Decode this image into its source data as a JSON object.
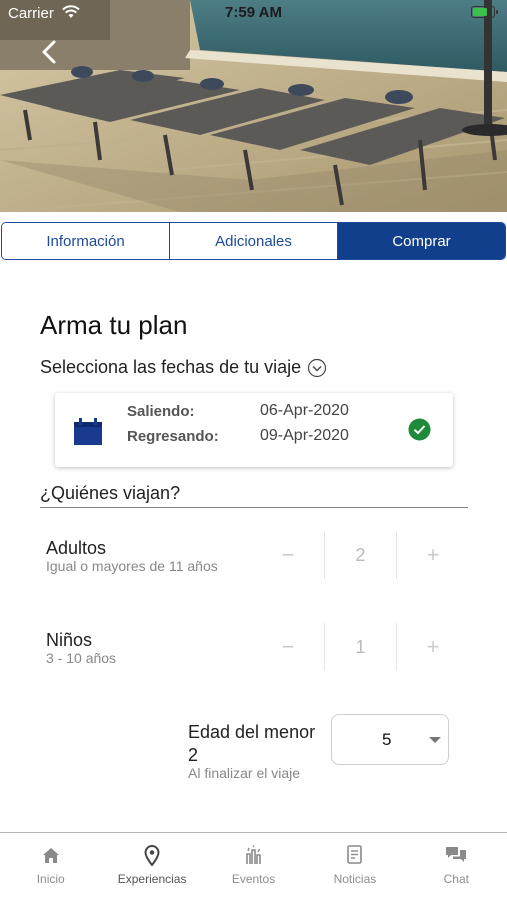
{
  "status_bar": {
    "carrier": "Carrier",
    "time": "7:59 AM"
  },
  "tabs": [
    {
      "label": "Información",
      "active": false
    },
    {
      "label": "Adicionales",
      "active": false
    },
    {
      "label": "Comprar",
      "active": true
    }
  ],
  "plan": {
    "title": "Arma tu plan",
    "dates_prompt": "Selecciona las fechas de tu viaje",
    "departing_label": "Saliendo:",
    "departing_date": "06-Apr-2020",
    "returning_label": "Regresando:",
    "returning_date": "09-Apr-2020"
  },
  "travelers": {
    "heading": "¿Quiénes viajan?",
    "adults": {
      "label": "Adultos",
      "description": "Igual o mayores de 11 años",
      "count": "2"
    },
    "children": {
      "label": "Niños",
      "description": "3 - 10 años",
      "count": "1"
    },
    "stepper_minus": "−",
    "stepper_plus": "+"
  },
  "child_age": {
    "label": "Edad del menor 2",
    "note": "Al finalizar el viaje",
    "selected": "5"
  },
  "bottom_nav": [
    {
      "label": "Inicio",
      "icon": "home-icon"
    },
    {
      "label": "Experiencias",
      "icon": "map-pin-icon",
      "active": true
    },
    {
      "label": "Eventos",
      "icon": "events-icon"
    },
    {
      "label": "Noticias",
      "icon": "news-icon"
    },
    {
      "label": "Chat",
      "icon": "chat-icon"
    }
  ],
  "colors": {
    "primary": "#123f8c",
    "tab_border": "#1d4a9a",
    "calendar": "#1a3a8f",
    "success": "#1e8a3a"
  }
}
